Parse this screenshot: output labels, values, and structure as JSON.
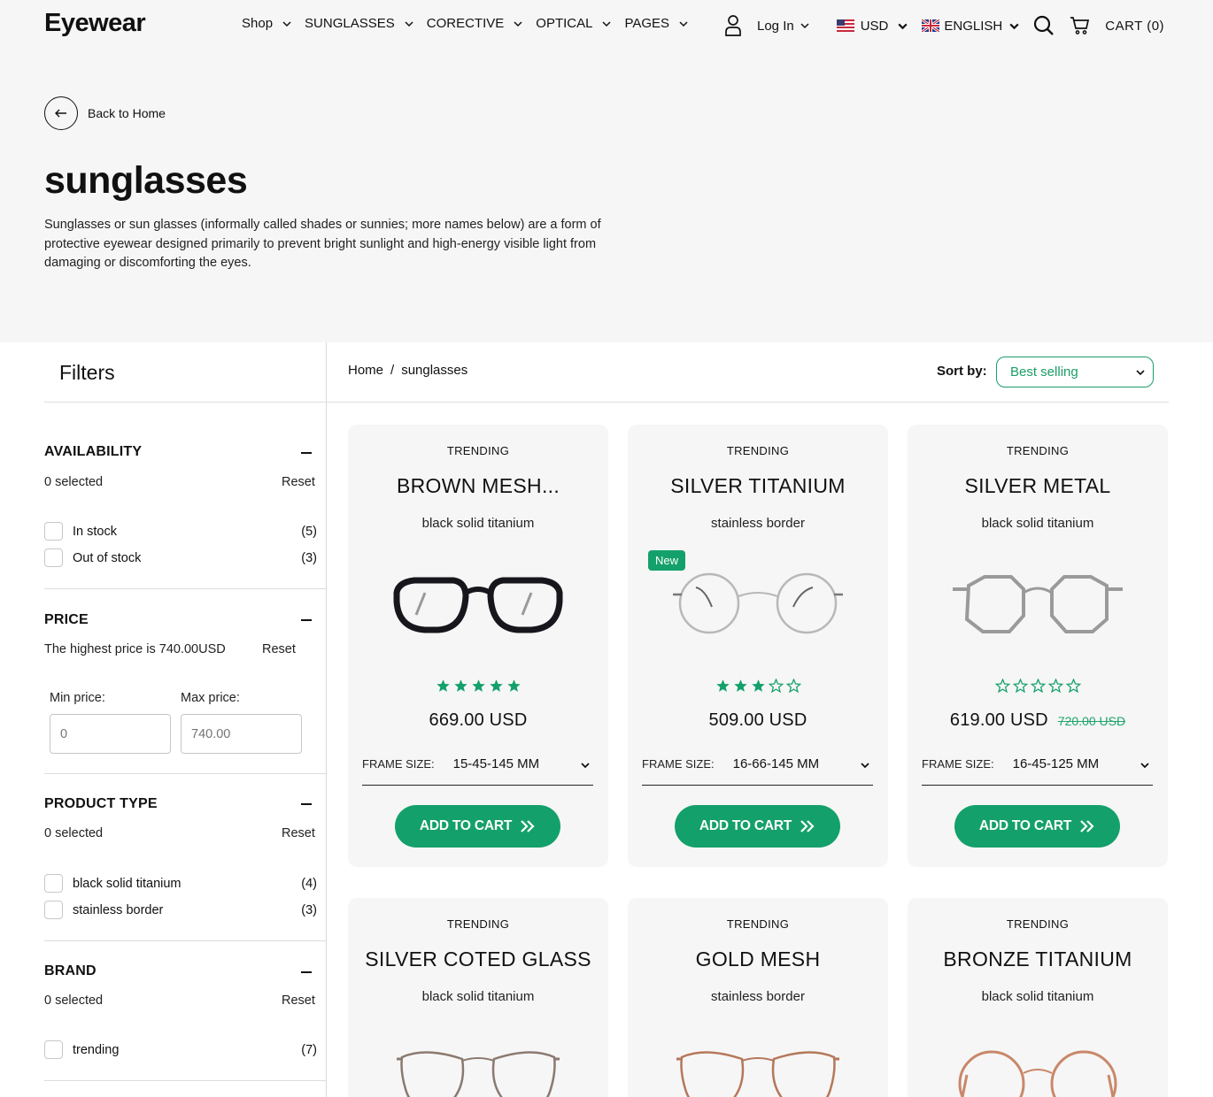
{
  "header": {
    "logo": "Eyewear",
    "nav": [
      {
        "label": "Shop"
      },
      {
        "label": "SUNGLASSES"
      },
      {
        "label": "CORECTIVE"
      },
      {
        "label": "OPTICAL"
      },
      {
        "label": "PAGES"
      }
    ],
    "login_label": "Log In",
    "currency": "USD",
    "language": "ENGLISH",
    "cart_label": "CART (0)"
  },
  "hero": {
    "back_label": "Back to Home",
    "title": "sunglasses",
    "description": "Sunglasses or sun glasses (informally called shades or sunnies; more names below) are a form of protective eyewear designed primarily to prevent bright sunlight and high-energy visible light from damaging or discomforting the eyes."
  },
  "filters": {
    "title": "Filters",
    "availability": {
      "title": "AVAILABILITY",
      "selected": "0 selected",
      "reset": "Reset",
      "options": [
        {
          "label": "In stock",
          "count": "(5)"
        },
        {
          "label": "Out of stock",
          "count": "(3)"
        }
      ]
    },
    "price": {
      "title": "PRICE",
      "note": "The highest price is 740.00USD",
      "reset": "Reset",
      "min_label": "Min price:",
      "max_label": "Max price:",
      "min_placeholder": "0",
      "max_placeholder": "740.00"
    },
    "product_type": {
      "title": "PRODUCT TYPE",
      "selected": "0 selected",
      "reset": "Reset",
      "options": [
        {
          "label": "black solid titanium",
          "count": "(4)"
        },
        {
          "label": "stainless border",
          "count": "(3)"
        }
      ]
    },
    "brand": {
      "title": "BRAND",
      "selected": "0 selected",
      "reset": "Reset",
      "options": [
        {
          "label": "trending",
          "count": "(7)"
        }
      ]
    }
  },
  "main": {
    "breadcrumb": {
      "home": "Home",
      "sep": "/",
      "current": "sunglasses"
    },
    "sort_label": "Sort by:",
    "sort_value": "Best selling",
    "frame_label": "FRAME SIZE:",
    "add_to_cart": "ADD TO CART",
    "products": [
      {
        "tag": "TRENDING",
        "name": "BROWN MESH...",
        "type": "black solid titanium",
        "rating": 5,
        "price": "669.00 USD",
        "frame_size": "15-45-145 MM",
        "frame_color": "#16161c",
        "frame_style": "bold"
      },
      {
        "tag": "TRENDING",
        "name": "SILVER TITANIUM",
        "type": "stainless border",
        "badge": "New",
        "rating": 3,
        "price": "509.00 USD",
        "frame_size": "16-66-145 MM",
        "frame_color": "#b8b8b8",
        "frame_style": "thin"
      },
      {
        "tag": "TRENDING",
        "name": "SILVER METAL",
        "type": "black solid titanium",
        "rating": 0,
        "price": "619.00 USD",
        "compare_price": "720.00 USD",
        "frame_size": "16-45-125 MM",
        "frame_color": "#9a9a9a",
        "frame_style": "hex"
      },
      {
        "tag": "TRENDING",
        "name": "SILVER COTED GLASS",
        "type": "black solid titanium",
        "frame_color": "#8a7a70",
        "frame_style": "cat"
      },
      {
        "tag": "TRENDING",
        "name": "GOLD MESH",
        "type": "stainless border",
        "frame_color": "#b5785a",
        "frame_style": "cat"
      },
      {
        "tag": "TRENDING",
        "name": "BRONZE TITANIUM",
        "type": "black solid titanium",
        "frame_color": "#c9886a",
        "frame_style": "round"
      }
    ]
  }
}
